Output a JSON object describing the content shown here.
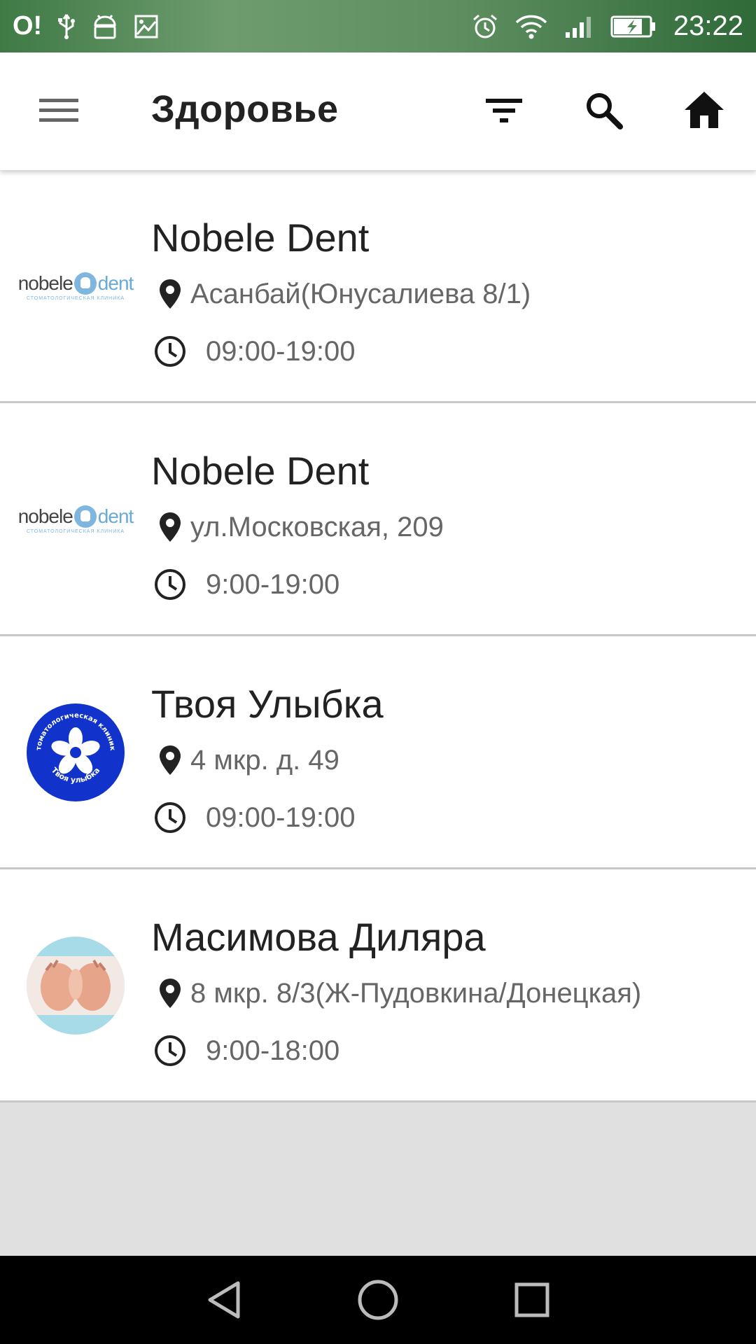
{
  "status_bar": {
    "carrier": "O!",
    "time": "23:22",
    "left_icons": [
      "usb-icon",
      "android-icon",
      "image-icon"
    ],
    "right_icons": [
      "alarm-icon",
      "wifi-icon",
      "signal-icon",
      "battery-charging-icon"
    ]
  },
  "app_bar": {
    "title": "Здоровье",
    "actions": [
      "menu-icon",
      "filter-icon",
      "search-icon",
      "home-icon"
    ]
  },
  "items": [
    {
      "title": "Nobele Dent",
      "address": "Асанбай(Юнусалиева 8/1)",
      "hours": "09:00-19:00",
      "logo": {
        "word1": "nobele",
        "word2": "dent",
        "sub": "СТОМАТОЛОГИЧЕСКАЯ КЛИНИКА"
      }
    },
    {
      "title": "Nobele Dent",
      "address": "ул.Московская, 209",
      "hours": "9:00-19:00",
      "logo": {
        "word1": "nobele",
        "word2": "dent",
        "sub": "СТОМАТОЛОГИЧЕСКАЯ КЛИНИКА"
      }
    },
    {
      "title": "Твоя Улыбка",
      "address": "4 мкр. д. 49",
      "hours": "09:00-19:00",
      "logo": {
        "top": "Стоматологическая клиника",
        "bottom": "Твоя улыбка"
      }
    },
    {
      "title": "Масимова Диляра",
      "address": "8 мкр. 8/3(Ж-Пудовкина/Донецкая)",
      "hours": "9:00-18:00"
    }
  ],
  "nav_bar": [
    "back-icon",
    "home-circle-icon",
    "recents-icon"
  ],
  "colors": {
    "status_bar": "#4f8653",
    "app_bar": "#ffffff",
    "list_bg": "#ffffff",
    "empty_bg": "#e0e0e0",
    "divider": "#c8c8c8",
    "nav_bar": "#000000",
    "blue_logo": "#1133cc"
  }
}
